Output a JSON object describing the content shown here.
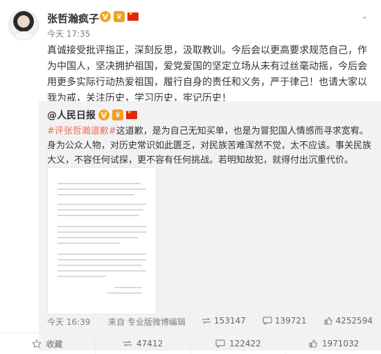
{
  "post": {
    "username": "张哲瀚疯子",
    "timestamp": "今天 17:35",
    "text": "真诚接受批评指正，深刻反思，汲取教训。今后会以更高要求规范自己，作为中国人，坚决拥护祖国，爱党爱国的坚定立场从未有过丝毫动摇，今后会用更多实际行动热爱祖国，履行自身的责任和义务，严于律己！也请大家以我为戒，关注历史，学习历史，牢记历史！"
  },
  "repost": {
    "author": "@人民日报",
    "hashtag": "#评张哲瀚道歉#",
    "text": "这道歉，是为自己无知买单，也是为冒犯国人情感而寻求宽宥。身为公众人物，对历史常识如此匮乏，对民族苦难浑然不觉，太不应该。事关民族大义，不容任何试探，更不容有任何挑战。若明知故犯，就得付出沉重代价。",
    "time": "今天 16:39",
    "via": "来自 专业版微博编辑",
    "stats": {
      "reposts": "153147",
      "comments": "139721",
      "likes": "4252594"
    }
  },
  "actions": {
    "favorite": "收藏",
    "repost_count": "47412",
    "comment_count": "122422",
    "like_count": "1971032"
  },
  "colors": {
    "hashtag": "#eb7350",
    "vip_badge": "#f5a623"
  }
}
